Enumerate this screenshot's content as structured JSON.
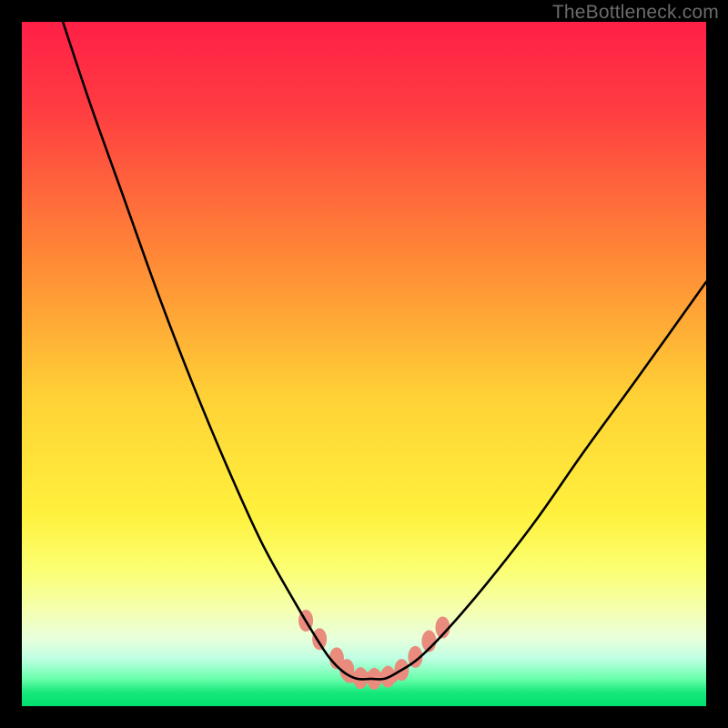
{
  "watermark": "TheBottleneck.com",
  "chart_data": {
    "type": "line",
    "title": "",
    "xlabel": "",
    "ylabel": "",
    "xlim": [
      0,
      100
    ],
    "ylim": [
      0,
      100
    ],
    "series": [
      {
        "name": "curve",
        "x": [
          6,
          10,
          15,
          20,
          25,
          30,
          35,
          40,
          43,
          45,
          47,
          49,
          51,
          53,
          55,
          58,
          62,
          68,
          75,
          82,
          90,
          100
        ],
        "values": [
          100,
          88,
          74,
          60,
          47,
          35,
          24,
          15,
          10,
          7,
          5,
          4,
          4,
          4,
          5,
          7,
          11,
          18,
          27,
          37,
          48,
          62
        ]
      }
    ],
    "markers": [
      {
        "x": 41.5,
        "y": 12.5
      },
      {
        "x": 43.5,
        "y": 9.8
      },
      {
        "x": 46.0,
        "y": 7.0
      },
      {
        "x": 47.5,
        "y": 5.3
      },
      {
        "x": 49.5,
        "y": 4.1
      },
      {
        "x": 51.5,
        "y": 4.0
      },
      {
        "x": 53.5,
        "y": 4.3
      },
      {
        "x": 55.5,
        "y": 5.3
      },
      {
        "x": 57.5,
        "y": 7.2
      },
      {
        "x": 59.5,
        "y": 9.5
      },
      {
        "x": 61.5,
        "y": 11.5
      }
    ],
    "marker_color": "#e98b7d",
    "trough_bar": {
      "x0": 47,
      "x1": 55,
      "y": 4.2
    }
  }
}
